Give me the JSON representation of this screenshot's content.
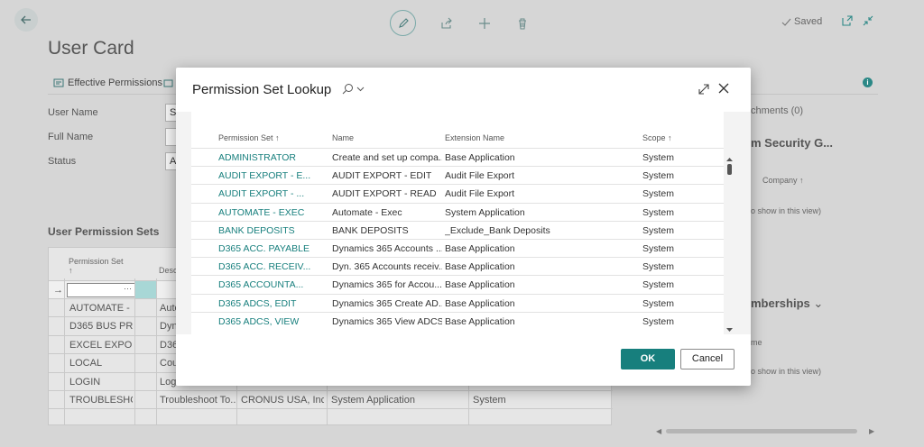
{
  "header": {
    "page_title": "User Card",
    "saved_label": "Saved"
  },
  "actions": {
    "effective_permissions": "Effective Permissions"
  },
  "fields": {
    "user_name_label": "User Name",
    "user_name_value": "SA",
    "full_name_label": "Full Name",
    "status_label": "Status",
    "status_value": "Ac"
  },
  "permission_sets_section": {
    "title": "User Permission Sets",
    "col_permission_set": "Permission Set",
    "col_description": "Desc",
    "rows": [
      {
        "set": "AUTOMATE - ...",
        "desc": "Auto",
        "company": "",
        "ext": "",
        "scope": ""
      },
      {
        "set": "D365 BUS PR...",
        "desc": "Dyn",
        "company": "",
        "ext": "",
        "scope": ""
      },
      {
        "set": "EXCEL EXPOR...",
        "desc": "D36",
        "company": "",
        "ext": "",
        "scope": ""
      },
      {
        "set": "LOCAL",
        "desc": "Cou",
        "company": "",
        "ext": "",
        "scope": ""
      },
      {
        "set": "LOGIN",
        "desc": "Logi",
        "company": "",
        "ext": "",
        "scope": ""
      },
      {
        "set": "TROUBLESHO...",
        "desc": "Troubleshoot To...",
        "company": "CRONUS USA, Inc.",
        "ext": "System Application",
        "scope": "System"
      }
    ]
  },
  "right_pane": {
    "attachments": "chments (0)",
    "security_group": "m Security G...",
    "company_col": "Company",
    "nothing_1": "o show in this view)",
    "memberships": "mberships",
    "name_col": "me",
    "nothing_2": "o show in this view)"
  },
  "modal": {
    "title": "Permission Set Lookup",
    "columns": {
      "permission_set": "Permission Set",
      "name": "Name",
      "extension_name": "Extension Name",
      "scope": "Scope"
    },
    "rows": [
      {
        "set": "ADMINISTRATOR",
        "name": "Create and set up compa...",
        "ext": "Base Application",
        "scope": "System"
      },
      {
        "set": "AUDIT EXPORT - E...",
        "name": "AUDIT EXPORT - EDIT",
        "ext": "Audit File Export",
        "scope": "System"
      },
      {
        "set": "AUDIT EXPORT - ...",
        "name": "AUDIT EXPORT - READ",
        "ext": "Audit File Export",
        "scope": "System"
      },
      {
        "set": "AUTOMATE - EXEC",
        "name": "Automate - Exec",
        "ext": "System Application",
        "scope": "System"
      },
      {
        "set": "BANK DEPOSITS",
        "name": "BANK DEPOSITS",
        "ext": "_Exclude_Bank Deposits",
        "scope": "System"
      },
      {
        "set": "D365 ACC. PAYABLE",
        "name": "Dynamics 365 Accounts ...",
        "ext": "Base Application",
        "scope": "System"
      },
      {
        "set": "D365 ACC. RECEIV...",
        "name": "Dyn. 365 Accounts receiv...",
        "ext": "Base Application",
        "scope": "System"
      },
      {
        "set": "D365 ACCOUNTA...",
        "name": "Dynamics 365 for Accou...",
        "ext": "Base Application",
        "scope": "System"
      },
      {
        "set": "D365 ADCS, EDIT",
        "name": "Dynamics 365 Create AD...",
        "ext": "Base Application",
        "scope": "System"
      },
      {
        "set": "D365 ADCS, VIEW",
        "name": "Dynamics 365 View ADCS",
        "ext": "Base Application",
        "scope": "System"
      }
    ],
    "ok_label": "OK",
    "cancel_label": "Cancel"
  },
  "colors": {
    "accent": "#177f7d",
    "background_dim": "#d6d6d6"
  }
}
